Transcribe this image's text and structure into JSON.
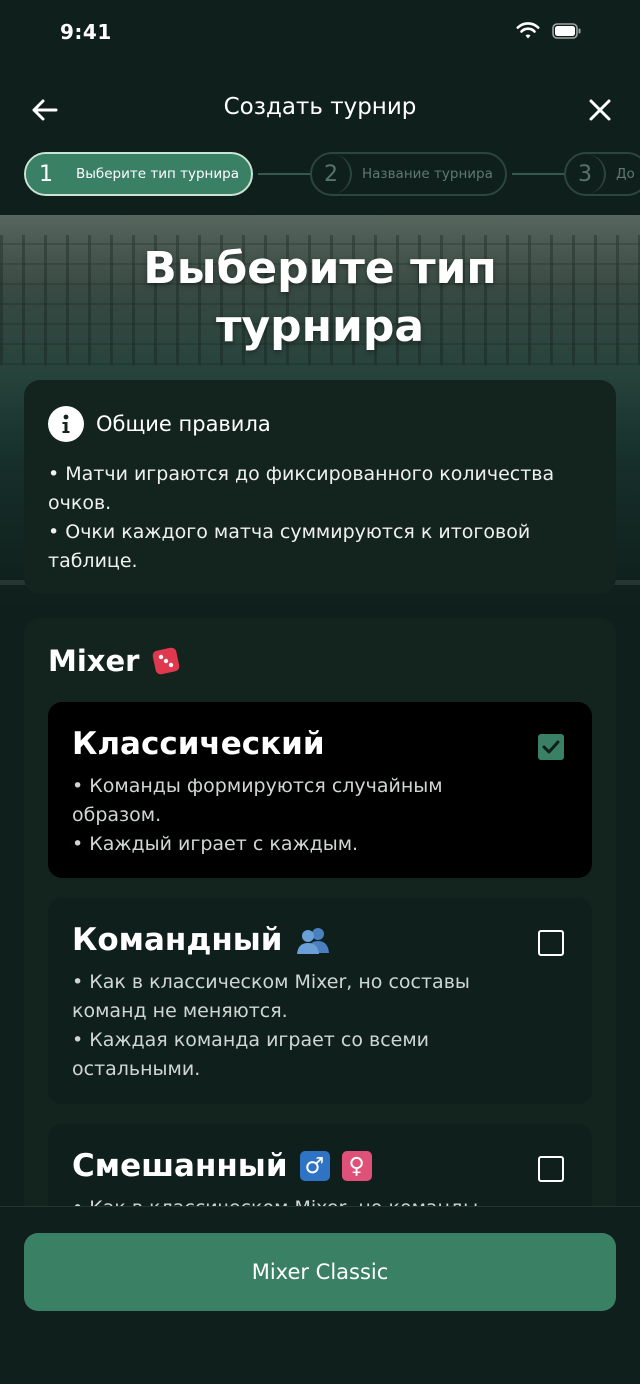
{
  "status_bar": {
    "time": "9:41"
  },
  "header": {
    "title": "Создать турнир"
  },
  "stepper": [
    {
      "number": "1",
      "label": "Выберите тип турнира",
      "state": "active"
    },
    {
      "number": "2",
      "label": "Название турнира",
      "state": "inactive"
    },
    {
      "number": "3",
      "label": "До",
      "state": "inactive"
    }
  ],
  "page": {
    "heading_line1": "Выберите тип",
    "heading_line2": "турнира"
  },
  "rules": {
    "title": "Общие правила",
    "line1": "• Матчи играются до фиксированного количества",
    "line1b": "очков.",
    "line2": "• Очки каждого матча суммируются к итоговой",
    "line2b": "таблице."
  },
  "mixer": {
    "title": "Mixer",
    "title_emoji": "🎲",
    "options": [
      {
        "title": "Классический",
        "emoji": "",
        "desc1": "• Команды формируются случайным",
        "desc1b": "образом.",
        "desc2": "• Каждый играет с каждым.",
        "desc2b": "",
        "selected": true
      },
      {
        "title": "Командный",
        "emoji": "👥",
        "desc1": "• Как в классическом Mixer, но составы",
        "desc1b": "команд не меняются.",
        "desc2": "• Каждая команда играет со всеми",
        "desc2b": "остальными.",
        "selected": false
      },
      {
        "title": "Смешанный",
        "emoji_male": "♂",
        "emoji_female": "♀",
        "desc1": "• Как в классическом Mixer, но команды",
        "selected": false
      }
    ]
  },
  "bottom": {
    "button_label": "Mixer Classic"
  },
  "colors": {
    "accent": "#3a8064",
    "background": "#0f1f1b",
    "card": "#13241f",
    "male_badge": "#2f73c4",
    "female_badge": "#e0517a"
  },
  "icons": [
    "back-arrow-icon",
    "close-icon",
    "wifi-icon",
    "battery-icon",
    "info-icon",
    "dice-icon",
    "checkmark-icon",
    "people-icon",
    "male-sign-icon",
    "female-sign-icon"
  ]
}
